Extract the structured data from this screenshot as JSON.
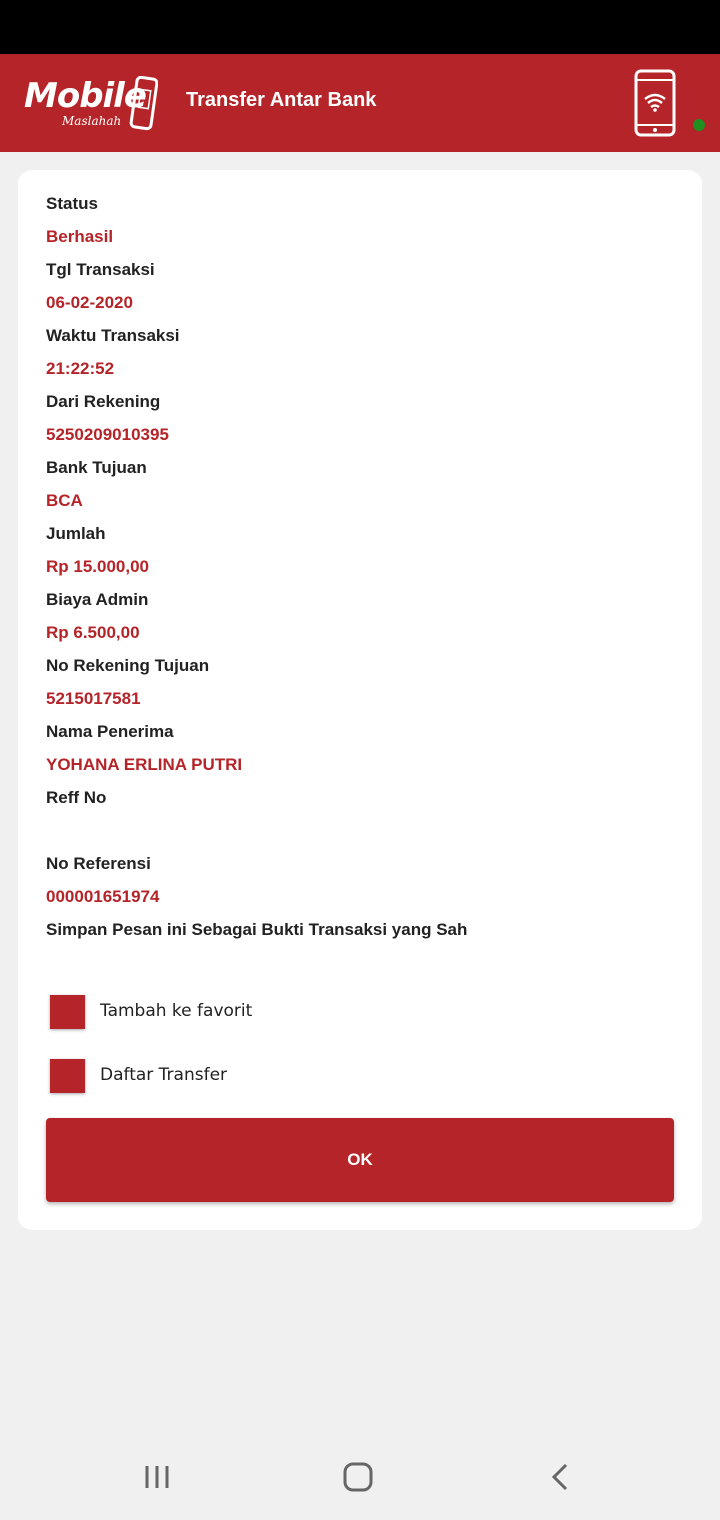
{
  "header": {
    "logo_text": "Mobile",
    "logo_sub": "Maslahah",
    "title": "Transfer Antar Bank",
    "phone_icon": "smartphone-wifi-icon",
    "status_color": "#1f8f1f"
  },
  "colors": {
    "primary": "#b52428",
    "background": "#f0f0f0"
  },
  "receipt": {
    "status_label": "Status",
    "status_value": "Berhasil",
    "date_label": "Tgl Transaksi",
    "date_value": "06-02-2020",
    "time_label": "Waktu Transaksi",
    "time_value": "21:22:52",
    "from_label": "Dari Rekening",
    "from_value": "5250209010395",
    "bank_label": "Bank Tujuan",
    "bank_value": "BCA",
    "amount_label": "Jumlah",
    "amount_value": "Rp 15.000,00",
    "fee_label": "Biaya Admin",
    "fee_value": "Rp 6.500,00",
    "dest_label": "No Rekening Tujuan",
    "dest_value": "5215017581",
    "recipient_label": "Nama Penerima",
    "recipient_value": "YOHANA ERLINA PUTRI",
    "reff_label": "Reff No",
    "reff_value": "",
    "ref_label": "No Referensi",
    "ref_value": "000001651974",
    "note": "Simpan Pesan ini Sebagai Bukti Transaksi yang Sah"
  },
  "options": {
    "favorite_label": "Tambah ke favorit",
    "transfer_list_label": "Daftar Transfer"
  },
  "actions": {
    "ok_label": "OK"
  },
  "nav": {
    "recent_icon": "recent-apps-icon",
    "home_icon": "home-icon",
    "back_icon": "back-icon"
  }
}
